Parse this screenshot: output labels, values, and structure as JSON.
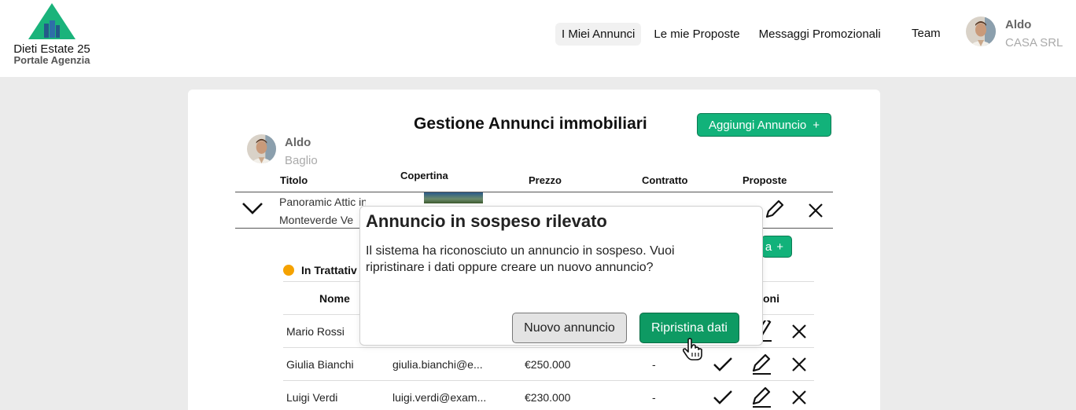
{
  "header": {
    "brand_title": "Dieti Estate 25",
    "brand_subtitle": "Portale Agenzia",
    "nav": [
      "I Miei Annunci",
      "Le mie Proposte",
      "Messaggi Promozionali",
      "Team"
    ],
    "user_name": "Aldo",
    "user_company": "CASA SRL"
  },
  "main": {
    "title": "Gestione Annunci immobiliari",
    "add_button": "Aggiungi Annuncio",
    "owner_name": "Aldo",
    "owner_surname": "Baglio",
    "columns": [
      "Titolo",
      "Copertina",
      "Prezzo",
      "Contratto",
      "Proposte"
    ],
    "listing_title_line1": "Panoramic Attic in",
    "listing_title_line2": "Monteverde Ve"
  },
  "proposals": {
    "add_button_fragment": "a",
    "status": "In Trattativ",
    "columns": [
      "Nome",
      "oni"
    ],
    "rows": [
      {
        "name": "Mario Rossi",
        "email": "",
        "price": "",
        "counter": ""
      },
      {
        "name": "Giulia Bianchi",
        "email": "giulia.bianchi@e...",
        "price": "€250.000",
        "counter": "-"
      },
      {
        "name": "Luigi Verdi",
        "email": "luigi.verdi@exam...",
        "price": "€230.000",
        "counter": "-"
      }
    ]
  },
  "dialog": {
    "title": "Annuncio in sospeso rilevato",
    "message": "Il sistema ha riconosciuto un annuncio in sospeso. Vuoi ripristinare i dati oppure creare un nuovo annuncio?",
    "new_button": "Nuovo annuncio",
    "restore_button": "Ripristina dati"
  },
  "colors": {
    "accent": "#12b27a",
    "accent_dark": "#0e9a63",
    "status_dot": "#f5a200"
  }
}
